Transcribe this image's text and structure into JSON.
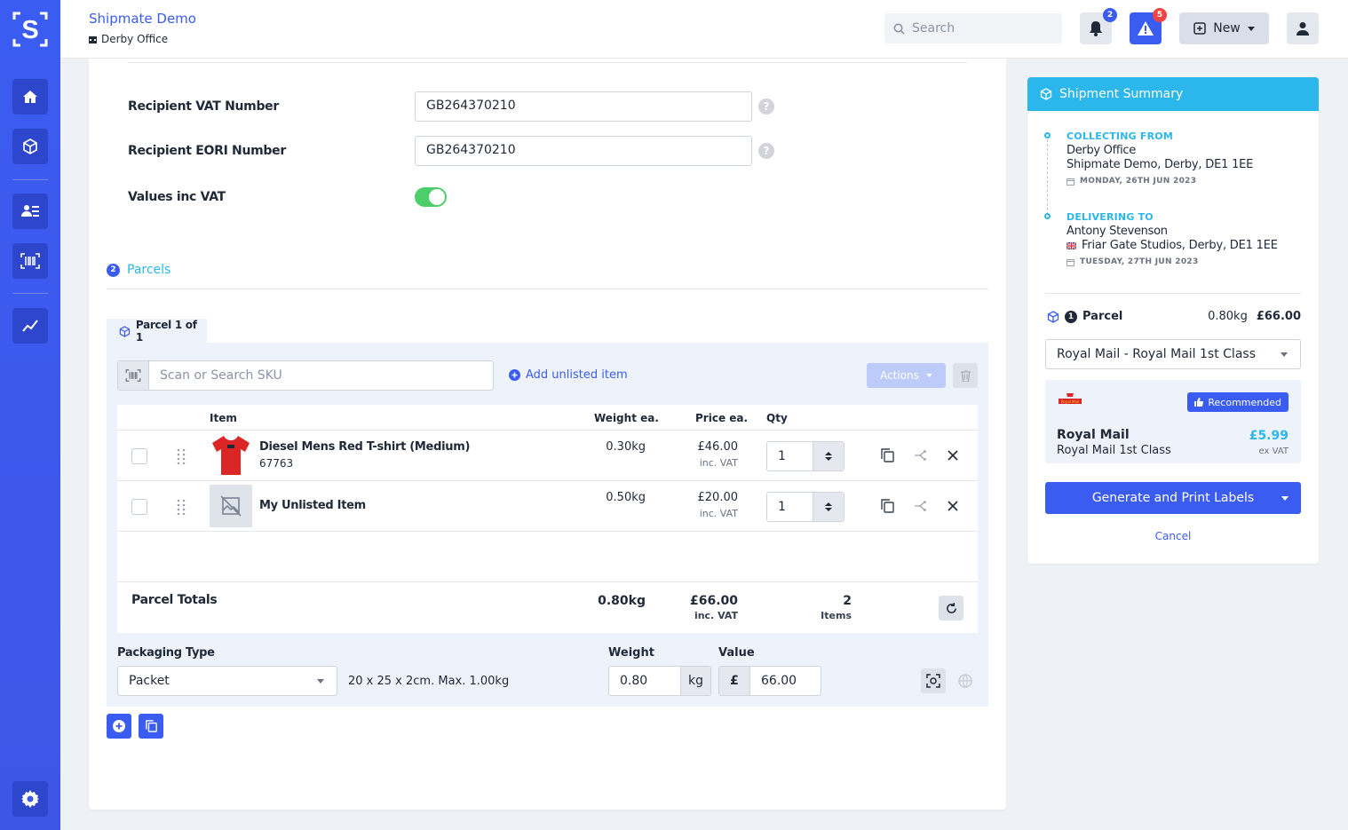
{
  "header": {
    "app_name": "Shipmate Demo",
    "office": "Derby Office",
    "search_placeholder": "Search",
    "notifications_count": "2",
    "alerts_count": "5",
    "new_label": "New"
  },
  "form": {
    "vat_label": "Recipient VAT Number",
    "vat_value": "GB264370210",
    "eori_label": "Recipient EORI Number",
    "eori_value": "GB264370210",
    "values_inc_vat_label": "Values inc VAT",
    "values_inc_vat_on": true,
    "help": "?"
  },
  "parcels": {
    "step": "2",
    "title": "Parcels",
    "tab_label": "Parcel 1 of 1",
    "sku_placeholder": "Scan or Search SKU",
    "add_unlisted": "Add unlisted item",
    "actions_label": "Actions"
  },
  "table": {
    "headers": {
      "item": "Item",
      "weight": "Weight ea.",
      "price": "Price ea.",
      "qty": "Qty"
    },
    "rows": [
      {
        "name": "Diesel Mens Red T-shirt (Medium)",
        "sku": "67763",
        "weight": "0.30kg",
        "price": "£46.00",
        "price_note": "inc. VAT",
        "qty": "1"
      },
      {
        "name": "My Unlisted Item",
        "sku": "",
        "weight": "0.50kg",
        "price": "£20.00",
        "price_note": "inc. VAT",
        "qty": "1"
      }
    ],
    "totals": {
      "label": "Parcel Totals",
      "weight": "0.80kg",
      "price": "£66.00",
      "price_note": "inc. VAT",
      "count": "2",
      "count_label": "Items"
    }
  },
  "packaging": {
    "type_label": "Packaging Type",
    "type_value": "Packet",
    "dims": "20 x 25 x 2cm. Max. 1.00kg",
    "weight_label": "Weight",
    "weight_value": "0.80",
    "weight_unit": "kg",
    "value_label": "Value",
    "currency": "£",
    "value_value": "66.00"
  },
  "summary": {
    "title": "Shipment Summary",
    "collecting_caption": "COLLECTING FROM",
    "collecting_name": "Derby Office",
    "collecting_address": "Shipmate Demo, Derby, DE1 1EE",
    "collecting_date": "MONDAY, 26TH JUN 2023",
    "delivering_caption": "DELIVERING TO",
    "delivering_name": "Antony Stevenson",
    "delivering_address": "Friar Gate Studios, Derby, DE1 1EE",
    "delivering_date": "TUESDAY, 27TH JUN 2023",
    "parcel_count": "1",
    "parcel_label": "Parcel",
    "parcel_weight": "0.80kg",
    "parcel_price": "£66.00",
    "service_select": "Royal Mail - Royal Mail 1st Class",
    "recommended": "Recommended",
    "logo_text": "Royal Mail",
    "carrier": "Royal Mail",
    "service": "Royal Mail 1st Class",
    "price": "£5.99",
    "price_note": "ex VAT",
    "generate_label": "Generate and Print Labels",
    "cancel_label": "Cancel"
  },
  "colors": {
    "brand": "#3b5cf0",
    "accent": "#2bb7ec",
    "toggle": "#4ccf6b",
    "alert": "#ef4444"
  }
}
